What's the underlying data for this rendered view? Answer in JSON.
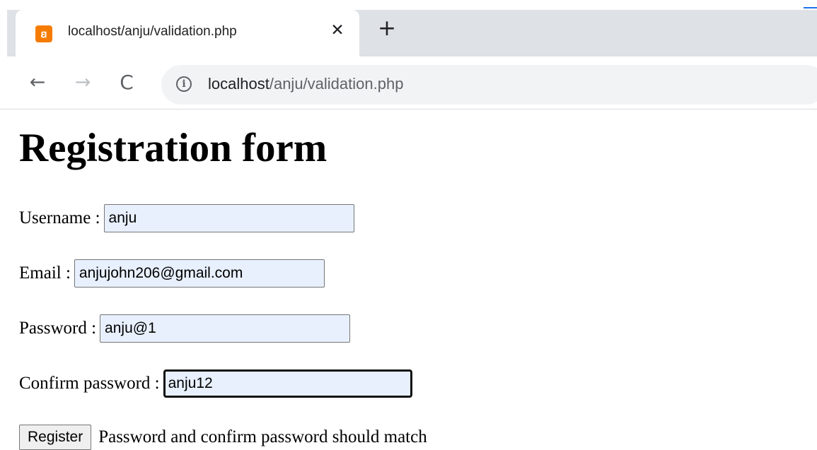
{
  "browser": {
    "tab_title": "localhost/anju/validation.php",
    "tab_close_glyph": "✕",
    "new_tab_glyph": "+",
    "favicon_glyph": "ꞛ",
    "favicon_color": "#f57c00",
    "back_glyph": "←",
    "forward_glyph": "→",
    "reload_glyph": "C",
    "info_glyph": "i",
    "url_host": "localhost",
    "url_path": "/anju/validation.php",
    "icons": [
      "xampp-favicon-icon",
      "close-icon",
      "plus-icon",
      "back-arrow-icon",
      "forward-arrow-icon",
      "reload-icon",
      "info-icon"
    ]
  },
  "page": {
    "title": "Registration form",
    "fields": {
      "username": {
        "label": "Username :",
        "value": "anju"
      },
      "email": {
        "label": "Email :",
        "value": "anjujohn206@gmail.com"
      },
      "password": {
        "label": "Password :",
        "value": "anju@1"
      },
      "confirm_password": {
        "label": "Confirm password :",
        "value": "anju12",
        "focused": true
      }
    },
    "submit_label": "Register",
    "error_message": "Password and confirm password should match"
  },
  "colors": {
    "autofill_background": "#e8f0fe",
    "tabstrip": "#dee1e6",
    "omnibox": "#f1f3f4"
  }
}
